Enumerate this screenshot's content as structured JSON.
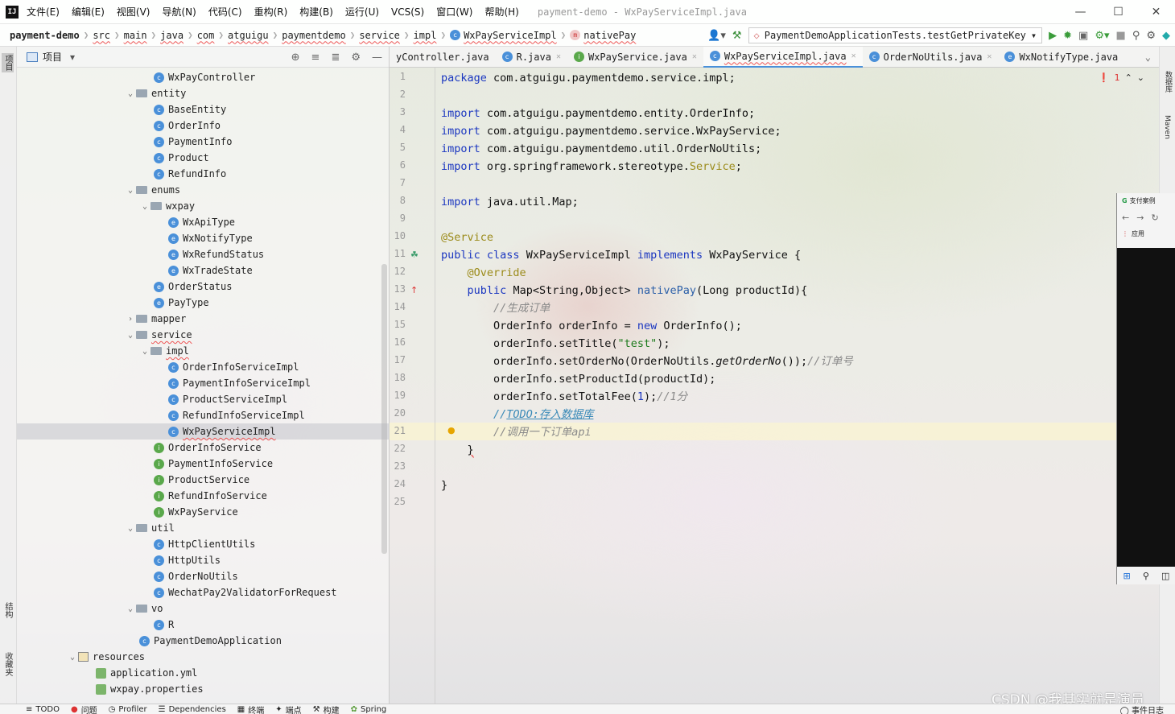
{
  "menubar": {
    "logo": "IJ",
    "items": [
      "文件(E)",
      "编辑(E)",
      "视图(V)",
      "导航(N)",
      "代码(C)",
      "重构(R)",
      "构建(B)",
      "运行(U)",
      "VCS(S)",
      "窗口(W)",
      "帮助(H)"
    ],
    "window_title": "payment-demo - WxPayServiceImpl.java"
  },
  "breadcrumb": [
    "payment-demo",
    "src",
    "main",
    "java",
    "com",
    "atguigu",
    "paymentdemo",
    "service",
    "impl",
    "WxPayServiceImpl",
    "nativePay"
  ],
  "run_config": "PaymentDemoApplicationTests.testGetPrivateKey",
  "left_stripe": {
    "project": "项目",
    "structure": "结构",
    "favorites": "收藏夹"
  },
  "project_panel": {
    "title": "项目"
  },
  "tree": [
    {
      "label": "WxPayController",
      "icon": "C"
    },
    {
      "label": "entity",
      "folder": true,
      "open": true
    },
    {
      "label": "BaseEntity",
      "icon": "C"
    },
    {
      "label": "OrderInfo",
      "icon": "C"
    },
    {
      "label": "PaymentInfo",
      "icon": "C"
    },
    {
      "label": "Product",
      "icon": "C"
    },
    {
      "label": "RefundInfo",
      "icon": "C"
    },
    {
      "label": "enums",
      "folder": true,
      "open": true
    },
    {
      "label": "wxpay",
      "folder": true,
      "open": true
    },
    {
      "label": "WxApiType",
      "icon": "E"
    },
    {
      "label": "WxNotifyType",
      "icon": "E"
    },
    {
      "label": "WxRefundStatus",
      "icon": "E"
    },
    {
      "label": "WxTradeState",
      "icon": "E"
    },
    {
      "label": "OrderStatus",
      "icon": "E"
    },
    {
      "label": "PayType",
      "icon": "E"
    },
    {
      "label": "mapper",
      "folder": true,
      "open": false
    },
    {
      "label": "service",
      "folder": true,
      "open": true
    },
    {
      "label": "impl",
      "folder": true,
      "open": true
    },
    {
      "label": "OrderInfoServiceImpl",
      "icon": "C"
    },
    {
      "label": "PaymentInfoServiceImpl",
      "icon": "C"
    },
    {
      "label": "ProductServiceImpl",
      "icon": "C"
    },
    {
      "label": "RefundInfoServiceImpl",
      "icon": "C"
    },
    {
      "label": "WxPayServiceImpl",
      "icon": "C",
      "selected": true
    },
    {
      "label": "OrderInfoService",
      "icon": "I"
    },
    {
      "label": "PaymentInfoService",
      "icon": "I"
    },
    {
      "label": "ProductService",
      "icon": "I"
    },
    {
      "label": "RefundInfoService",
      "icon": "I"
    },
    {
      "label": "WxPayService",
      "icon": "I"
    },
    {
      "label": "util",
      "folder": true,
      "open": true
    },
    {
      "label": "HttpClientUtils",
      "icon": "C"
    },
    {
      "label": "HttpUtils",
      "icon": "C"
    },
    {
      "label": "OrderNoUtils",
      "icon": "C"
    },
    {
      "label": "WechatPay2ValidatorForRequest",
      "icon": "C"
    },
    {
      "label": "vo",
      "folder": true,
      "open": true
    },
    {
      "label": "R",
      "icon": "C"
    },
    {
      "label": "PaymentDemoApplication",
      "icon": "C"
    },
    {
      "label": "resources",
      "folder": true,
      "open": true
    },
    {
      "label": "application.yml",
      "icon": "Y"
    },
    {
      "label": "wxpay.properties",
      "icon": "Y"
    }
  ],
  "editor_tabs": [
    {
      "label": "yController.java",
      "icon": ""
    },
    {
      "label": "R.java",
      "icon": "C"
    },
    {
      "label": "WxPayService.java",
      "icon": "I"
    },
    {
      "label": "WxPayServiceImpl.java",
      "icon": "C",
      "active": true
    },
    {
      "label": "OrderNoUtils.java",
      "icon": "C"
    },
    {
      "label": "WxNotifyType.java",
      "icon": "E"
    }
  ],
  "editor": {
    "error_count": "1"
  },
  "code": {
    "package": "com.atguigu.paymentdemo.service.impl;",
    "imp1": "com.atguigu.paymentdemo.entity.OrderInfo;",
    "imp2": "com.atguigu.paymentdemo.service.WxPayService;",
    "imp3": "com.atguigu.paymentdemo.util.OrderNoUtils;",
    "imp4a": "org.springframework.stereotype.",
    "imp4b": "Service",
    "imp5": "java.util.Map;",
    "anno_service": "@Service",
    "class_name": "WxPayServiceImpl",
    "iface": "WxPayService",
    "anno_override": "@Override",
    "ret_type": "Map<String,Object>",
    "method": "nativePay",
    "params": "(Long productId){",
    "c_gen": "//生成订单",
    "l15a": "OrderInfo orderInfo = ",
    "l15b": "OrderInfo();",
    "l16a": "orderInfo.setTitle(",
    "l16b": "\"test\"",
    "l17a": "orderInfo.setOrderNo(OrderNoUtils.",
    "l17b": "getOrderNo",
    "l17c": "());",
    "c_orderno": "//订单号",
    "l18": "orderInfo.setProductId(productId);",
    "l19a": "orderInfo.setTotalFee(",
    "l19b": "1",
    "l19c": ");",
    "c_fen": "//1分",
    "todo_a": "//",
    "todo_b": "TODO:存入数据库",
    "c_call": "//调用一下订单api"
  },
  "mini_browser": {
    "tab": "支付案例",
    "apps": "应用"
  },
  "right_stripe": {
    "db": "数据库",
    "maven": "Maven"
  },
  "bottom_bar": [
    "TODO",
    "问题",
    "Profiler",
    "Dependencies",
    "终端",
    "端点",
    "构建",
    "Spring"
  ],
  "event_log": "事件日志",
  "watermark": "CSDN @我其实就是演员"
}
